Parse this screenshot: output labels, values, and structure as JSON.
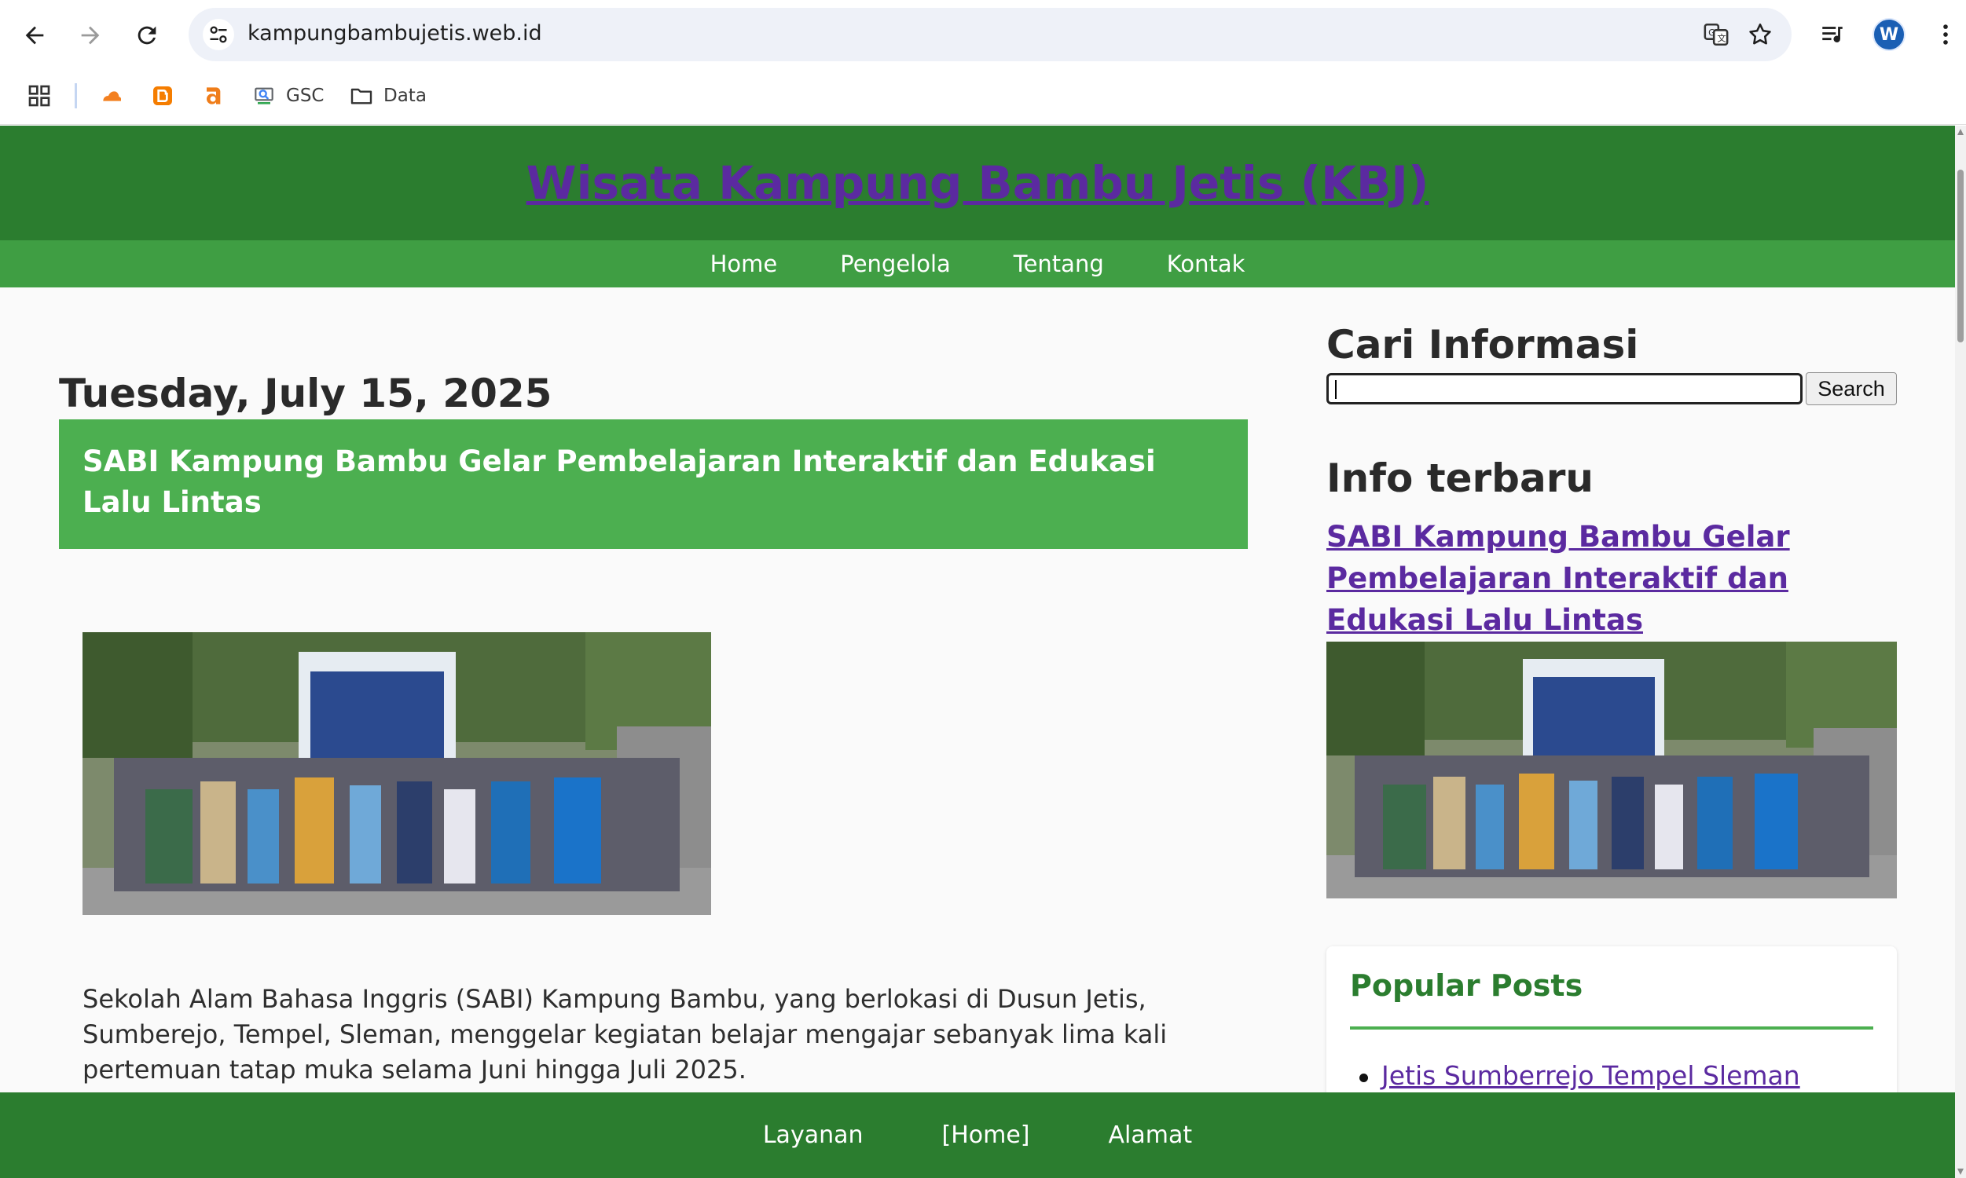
{
  "browser": {
    "url": "kampungbambujetis.web.id",
    "avatar_letter": "W",
    "bookmarks": [
      {
        "label": ""
      },
      {
        "label": ""
      },
      {
        "label": ""
      },
      {
        "label": "GSC"
      },
      {
        "label": "Data"
      }
    ]
  },
  "site": {
    "title": "Wisata Kampung Bambu Jetis (KBJ)",
    "nav": [
      "Home",
      "Pengelola",
      "Tentang",
      "Kontak"
    ],
    "footer": [
      "Layanan",
      "[Home]",
      "Alamat"
    ]
  },
  "post": {
    "date": "Tuesday, July 15, 2025",
    "title": "SABI Kampung Bambu Gelar Pembelajaran Interaktif dan Edukasi Lalu Lintas",
    "body": "Sekolah Alam Bahasa Inggris (SABI) Kampung Bambu, yang berlokasi di Dusun Jetis, Sumberejo, Tempel, Sleman, menggelar kegiatan belajar mengajar sebanyak lima kali pertemuan tatap muka selama Juni hingga Juli 2025."
  },
  "sidebar": {
    "search_title": "Cari Informasi",
    "search_value": "",
    "search_button": "Search",
    "latest_title": "Info terbaru",
    "latest_link": "SABI Kampung Bambu Gelar Pembelajaran Interaktif dan Edukasi Lalu Lintas",
    "popular_title": "Popular Posts",
    "popular_items": [
      "Jetis Sumberrejo Tempel Sleman"
    ]
  },
  "colors": {
    "header_green": "#2b7d2f",
    "nav_green": "#3f9e43",
    "title_box_green": "#4caf50",
    "link_purple": "#5b2aa0"
  }
}
